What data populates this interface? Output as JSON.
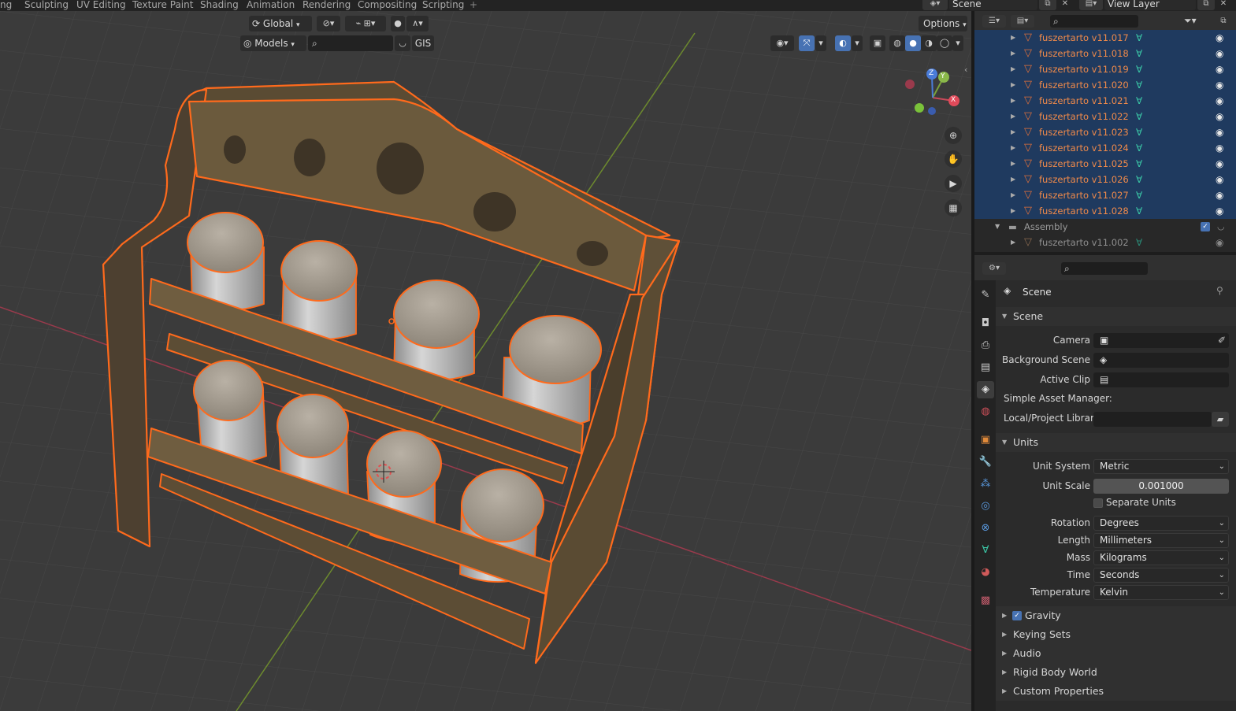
{
  "topbar": {
    "tabs": [
      "ng",
      "Sculpting",
      "UV Editing",
      "Texture Paint",
      "Shading",
      "Animation",
      "Rendering",
      "Compositing",
      "Scripting"
    ],
    "add_tab": "+",
    "scene_name": "Scene",
    "view_layer_name": "View Layer"
  },
  "viewport": {
    "transform_orientation": "Global",
    "asset_library": "Models",
    "gis_label": "GIS",
    "options_label": "Options",
    "gizmo": {
      "x": "X",
      "y": "Y",
      "z": "Z"
    },
    "colors": {
      "background": "#3b3b3b",
      "x_axis": "#9a3a4c",
      "y_axis": "#6d8a2e",
      "wood": "#6b5a3d",
      "selection_outline": "#ff6a1c",
      "jar": "#b3b3b3",
      "lid": "#a59c90"
    }
  },
  "outliner": {
    "items": [
      {
        "name": "fuszertarto v11.017",
        "selected": true
      },
      {
        "name": "fuszertarto v11.018",
        "selected": true
      },
      {
        "name": "fuszertarto v11.019",
        "selected": true
      },
      {
        "name": "fuszertarto v11.020",
        "selected": true
      },
      {
        "name": "fuszertarto v11.021",
        "selected": true
      },
      {
        "name": "fuszertarto v11.022",
        "selected": true
      },
      {
        "name": "fuszertarto v11.023",
        "selected": true
      },
      {
        "name": "fuszertarto v11.024",
        "selected": true
      },
      {
        "name": "fuszertarto v11.025",
        "selected": true
      },
      {
        "name": "fuszertarto v11.026",
        "selected": true
      },
      {
        "name": "fuszertarto v11.027",
        "selected": true
      },
      {
        "name": "fuszertarto v11.028",
        "selected": true
      }
    ],
    "collection": "Assembly",
    "collection_child": "fuszertarto v11.002",
    "colors": {
      "selected_row": "#1f3a5f",
      "object_name": "#f08a4a",
      "mesh_icon": "#3bc8a7"
    }
  },
  "properties": {
    "context_title": "Scene",
    "scene_panel": {
      "title": "Scene",
      "camera_label": "Camera",
      "camera_value": "",
      "background_scene_label": "Background Scene",
      "background_scene_value": "",
      "active_clip_label": "Active Clip",
      "active_clip_value": "",
      "asset_manager_label": "Simple Asset Manager:",
      "local_library_label": "Local/Project Librar...",
      "local_library_value": ""
    },
    "units_panel": {
      "title": "Units",
      "unit_system_label": "Unit System",
      "unit_system_value": "Metric",
      "unit_scale_label": "Unit Scale",
      "unit_scale_value": "0.001000",
      "separate_units_label": "Separate Units",
      "separate_units_checked": false,
      "rotation_label": "Rotation",
      "rotation_value": "Degrees",
      "length_label": "Length",
      "length_value": "Millimeters",
      "mass_label": "Mass",
      "mass_value": "Kilograms",
      "time_label": "Time",
      "time_value": "Seconds",
      "temperature_label": "Temperature",
      "temperature_value": "Kelvin"
    },
    "gravity": {
      "label": "Gravity",
      "checked": true
    },
    "collapsed_panels": [
      "Keying Sets",
      "Audio",
      "Rigid Body World",
      "Custom Properties"
    ]
  }
}
